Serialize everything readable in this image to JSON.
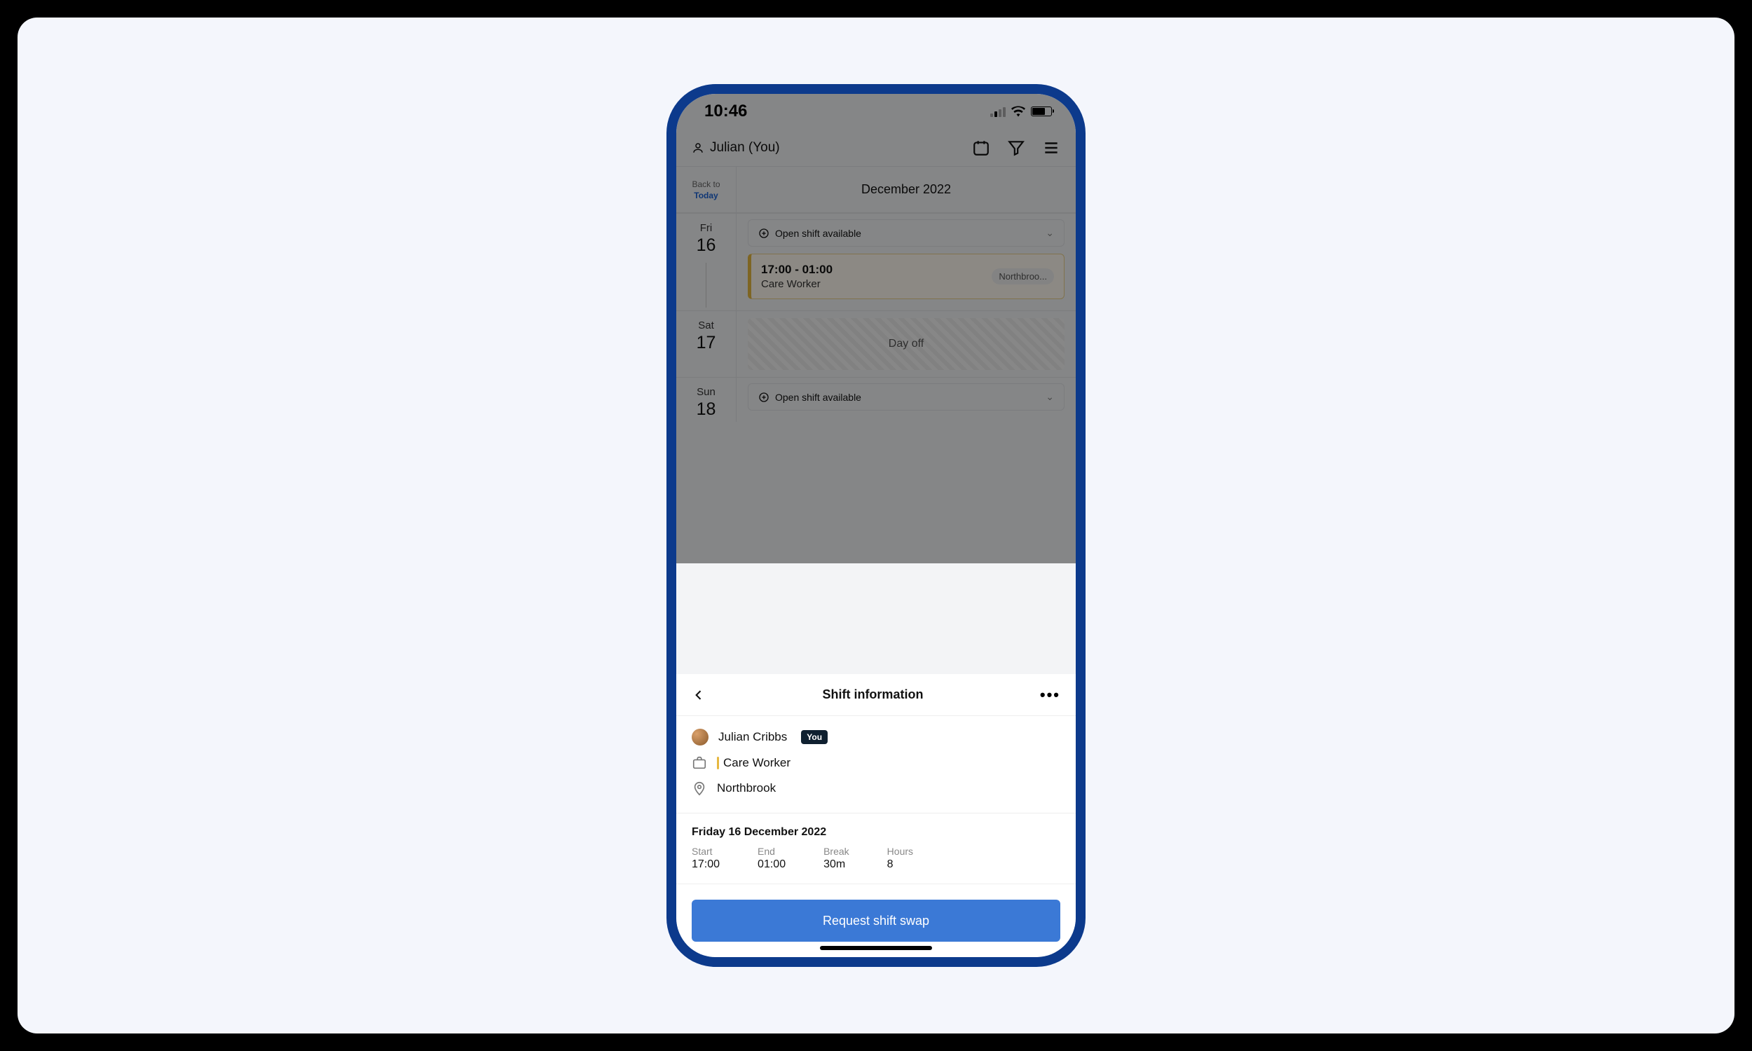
{
  "status": {
    "time": "10:46"
  },
  "header": {
    "user_label": "Julian (You)"
  },
  "subheader": {
    "back_line1": "Back to",
    "back_line2": "Today",
    "month": "December  2022"
  },
  "days": {
    "fri": {
      "dow": "Fri",
      "num": "16",
      "open": "Open shift available",
      "shift_time": "17:00 - 01:00",
      "shift_role": "Care Worker",
      "shift_loc": "Northbroo..."
    },
    "sat": {
      "dow": "Sat",
      "num": "17",
      "dayoff": "Day off"
    },
    "sun": {
      "dow": "Sun",
      "num": "18",
      "open": "Open shift available"
    }
  },
  "sheet": {
    "title": "Shift information",
    "name": "Julian Cribbs",
    "you": "You",
    "role": "Care Worker",
    "location": "Northbrook",
    "date": "Friday 16 December 2022",
    "start_l": "Start",
    "start_v": "17:00",
    "end_l": "End",
    "end_v": "01:00",
    "break_l": "Break",
    "break_v": "30m",
    "hours_l": "Hours",
    "hours_v": "8",
    "button": "Request shift swap"
  }
}
